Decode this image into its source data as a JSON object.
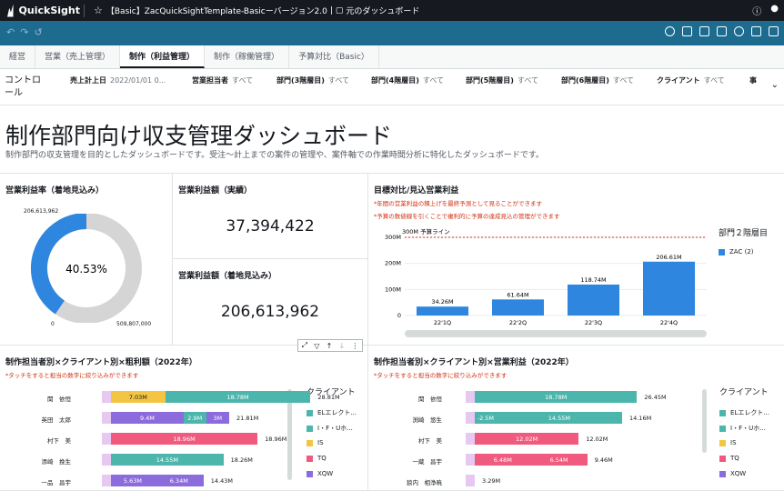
{
  "app": {
    "name": "QuickSight",
    "title": "【Basic】ZacQuickSightTemplate-Basicーバージョン2.0",
    "origin": "元のダッシュボード"
  },
  "tabs": [
    "経営",
    "営業（売上管理）",
    "制作（利益管理）",
    "制作（稼働管理）",
    "予算対比（Basic）"
  ],
  "controls": {
    "label": "コントロール",
    "items": [
      {
        "name": "売上計上日",
        "value": "2022/01/01 0..."
      },
      {
        "name": "営業担当者",
        "value": "すべて"
      },
      {
        "name": "部門(3階層目)",
        "value": "すべて"
      },
      {
        "name": "部門(4階層目)",
        "value": "すべて"
      },
      {
        "name": "部門(5階層目)",
        "value": "すべて"
      },
      {
        "name": "部門(6階層目)",
        "value": "すべて"
      },
      {
        "name": "クライアント",
        "value": "すべて"
      },
      {
        "name": "事",
        "value": ""
      }
    ]
  },
  "heading": "制作部門向け収支管理ダッシュボード",
  "subheading": "制作部門の収支管理を目的としたダッシュボードです。受注〜計上までの案件の管理や、案件軸での作業時間分析に特化したダッシュボードです。",
  "donut": {
    "title": "営業利益率（着地見込み）",
    "value": "40.53%",
    "fraction": 0.4053,
    "top_label": "206,613,962",
    "min_label": "0",
    "max_label": "509,807,000"
  },
  "kpi1": {
    "title": "営業利益額（実績）",
    "value": "37,394,422"
  },
  "kpi2": {
    "title": "営業利益額（着地見込み）",
    "value": "206,613,962"
  },
  "chart_data": [
    {
      "type": "bar",
      "title": "目標対比/見込営業利益",
      "notes": [
        "*年間の営業利益の積上げを最終予測として見ることができます",
        "*予算の数値線を引くことで複利的に予算の達成見込の管理ができます"
      ],
      "categories": [
        "22'1Q",
        "22'2Q",
        "22'3Q",
        "22'4Q"
      ],
      "values": [
        34.26,
        61.64,
        118.74,
        206.61
      ],
      "data_labels": [
        "34.26M",
        "61.64M",
        "118.74M",
        "206.61M"
      ],
      "yticks": [
        "0",
        "100M",
        "200M",
        "300M"
      ],
      "ylim": [
        0,
        300
      ],
      "target_line": {
        "label": "300M 予算ライン",
        "value": 300
      },
      "legend_title": "部門２階層目",
      "legend": [
        "ZAC (2)"
      ],
      "color": "#2e86de"
    },
    {
      "type": "bar",
      "title": "制作担当者別×クライアント別×粗利額（2022年）",
      "note": "*タッチをすると担当の数字に絞り込みができます",
      "rows": [
        {
          "name": "関　依恒",
          "segments": [
            {
              "v": 7.03,
              "c": 2,
              "l": "7.03M"
            },
            {
              "v": 18.78,
              "c": 0,
              "l": "18.78M"
            }
          ],
          "total": "28.81M"
        },
        {
          "name": "英田　太郎",
          "segments": [
            {
              "v": 9.4,
              "c": 4,
              "l": "9.4M"
            },
            {
              "v": 2.9,
              "c": 0,
              "l": "2.9M"
            },
            {
              "v": 3,
              "c": 4,
              "l": "3M"
            }
          ],
          "total": "21.81M"
        },
        {
          "name": "村下　美",
          "segments": [
            {
              "v": 18.96,
              "c": 3,
              "l": "18.96M"
            }
          ],
          "total": "18.96M"
        },
        {
          "name": "添崎　挽生",
          "segments": [
            {
              "v": 14.55,
              "c": 0,
              "l": "14.55M"
            }
          ],
          "total": "18.26M"
        },
        {
          "name": "一品　昌宇",
          "segments": [
            {
              "v": 5.63,
              "c": 4,
              "l": "5.63M"
            },
            {
              "v": 6.34,
              "c": 4,
              "l": "6.34M"
            }
          ],
          "total": "14.43M"
        }
      ],
      "legend_title": "クライアント",
      "legend": [
        "ELエレクト...",
        "I・F・Uホ...",
        "IS",
        "TQ",
        "XQW"
      ]
    },
    {
      "type": "bar",
      "title": "制作担当者別×クライアント別×営業利益（2022年）",
      "note": "*タッチをすると担当の数字に絞り込みができます",
      "rows": [
        {
          "name": "関　依恒",
          "segments": [
            {
              "v": 18.78,
              "c": 0,
              "l": "18.78M"
            }
          ],
          "total": "26.45M"
        },
        {
          "name": "渕崎　悠生",
          "segments": [
            {
              "v": -2.5,
              "c": 0,
              "l": "-2.5M"
            },
            {
              "v": 14.55,
              "c": 0,
              "l": "14.55M"
            }
          ],
          "total": "14.16M"
        },
        {
          "name": "村下　美",
          "segments": [
            {
              "v": 12.02,
              "c": 3,
              "l": "12.02M"
            }
          ],
          "total": "12.02M"
        },
        {
          "name": "一蔵　昌宇",
          "segments": [
            {
              "v": 6.48,
              "c": 3,
              "l": "6.48M"
            },
            {
              "v": 6.54,
              "c": 3,
              "l": "6.54M"
            }
          ],
          "total": "9.46M"
        },
        {
          "name": "狼内　相浄暁",
          "segments": [],
          "total": "3.29M"
        }
      ],
      "legend_title": "クライアント",
      "legend": [
        "ELエレクト...",
        "I・F・Uホ...",
        "IS",
        "TQ",
        "XQW"
      ]
    }
  ],
  "colors": {
    "teal": "#4db6ac",
    "yellow": "#f4c542",
    "pink": "#f05a7e",
    "purple": "#8c6bdc",
    "blue": "#2e86de",
    "grey": "#d5d5d5"
  }
}
